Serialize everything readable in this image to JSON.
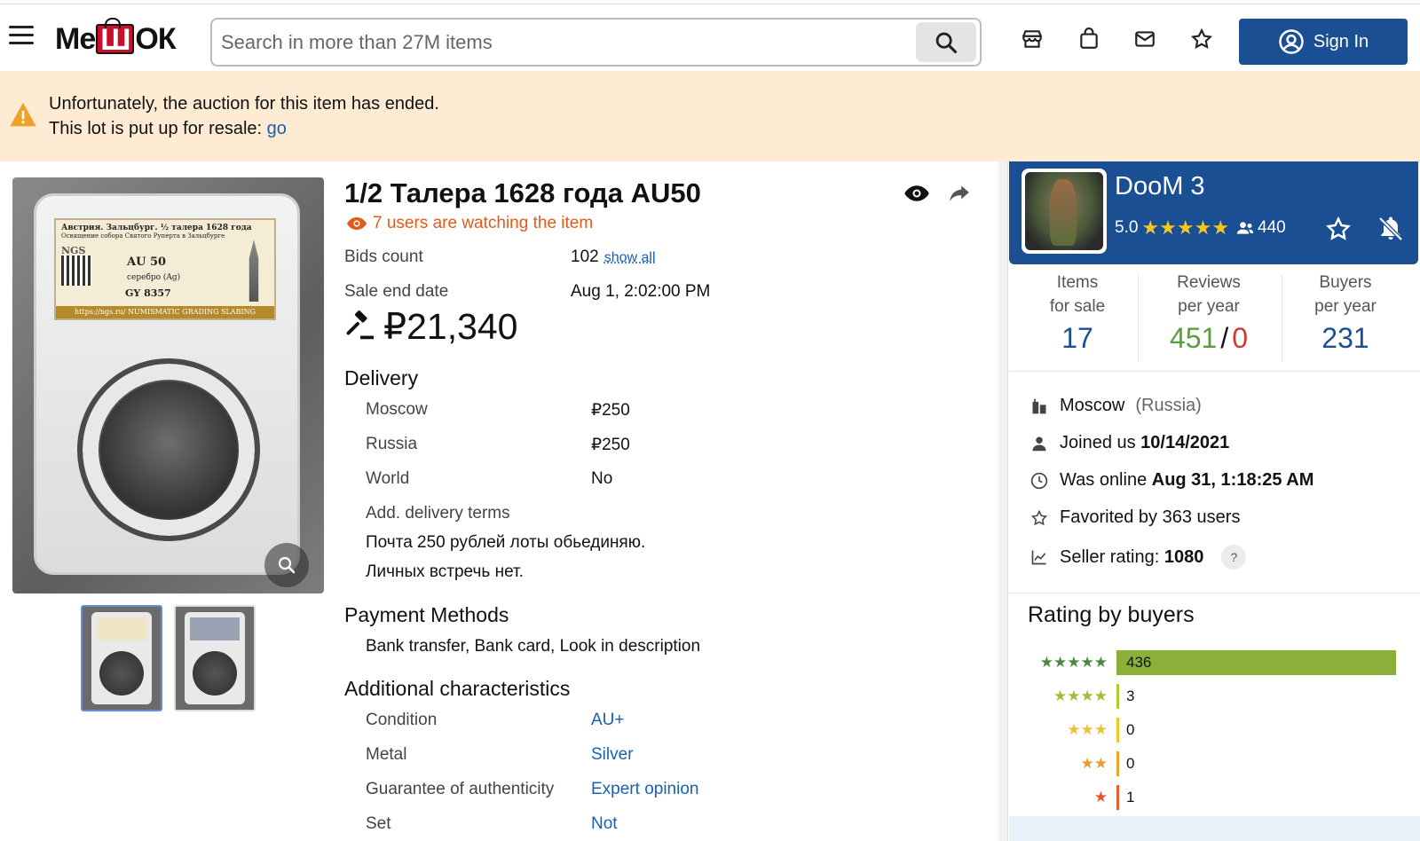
{
  "header": {
    "logo_prefix": "Ме",
    "logo_mid": "Ш",
    "logo_suffix": "ОК",
    "search_placeholder": "Search in more than 27M items",
    "sign_in": "Sign In",
    "icons": [
      "menu-icon",
      "search-icon",
      "store-icon",
      "bag-icon",
      "mail-icon",
      "star-icon",
      "user-circle-icon"
    ]
  },
  "banner": {
    "line1": "Unfortunately, the auction for this item has ended.",
    "line2_prefix": "This lot is put up for resale: ",
    "line2_link": "go"
  },
  "item": {
    "title": "1/2 Талера 1628 года AU50",
    "watching": "7 users are watching the item",
    "bids_label": "Bids count",
    "bids_value": "102",
    "bids_link": "show all",
    "sale_end_label": "Sale end date",
    "sale_end_value": "Aug 1, 2:02:00 PM",
    "price": "₽21,340",
    "image_label": {
      "line1": "Австрия. Зальцбург. ½ талера 1628 года",
      "line2": "Освящение собора Святого Руперта в Зальцбурге",
      "grade": "AU 50",
      "metal": "серебро (Ag)",
      "cert": "GY 8357",
      "brand": "NGS",
      "strip": "https://ngs.ru/ NUMISMATIC GRADING SLABING"
    }
  },
  "delivery": {
    "heading": "Delivery",
    "rows": [
      {
        "label": "Moscow",
        "value": "₽250"
      },
      {
        "label": "Russia",
        "value": "₽250"
      },
      {
        "label": "World",
        "value": "No"
      }
    ],
    "terms_label": "Add. delivery terms",
    "terms_line1": "Почта 250 рублей лоты обьединяю.",
    "terms_line2": "Личных встречь нет."
  },
  "payment": {
    "heading": "Payment Methods",
    "value": "Bank transfer, Bank card, Look in description"
  },
  "characteristics": {
    "heading": "Additional characteristics",
    "rows": [
      {
        "label": "Condition",
        "value": "AU+"
      },
      {
        "label": "Metal",
        "value": "Silver"
      },
      {
        "label": "Guarantee of authenticity",
        "value": "Expert opinion"
      },
      {
        "label": "Set",
        "value": "Not"
      }
    ]
  },
  "seller": {
    "name": "DooM 3",
    "rating": "5.0",
    "stars": "★★★★★",
    "followers": "440",
    "stats": [
      {
        "label1": "Items",
        "label2": "for sale",
        "value": "17"
      },
      {
        "label1": "Reviews",
        "label2": "per year",
        "positive": "451",
        "sep": "/",
        "negative": "0"
      },
      {
        "label1": "Buyers",
        "label2": "per year",
        "value": "231"
      }
    ],
    "city": "Moscow",
    "country": "(Russia)",
    "joined_prefix": "Joined us ",
    "joined_date": "10/14/2021",
    "online_prefix": "Was online ",
    "online_date": "Aug 31, 1:18:25 AM",
    "favorited": "Favorited by 363 users",
    "rating_prefix": "Seller rating: ",
    "rating_value": "1080",
    "help": "?"
  },
  "rating_by_buyers": {
    "heading": "Rating by buyers",
    "rows": [
      {
        "stars": "★★★★★",
        "count": "436",
        "fraction": 0.999,
        "color": "#8bb03a",
        "star_color": "#4b8a3a"
      },
      {
        "stars": "★★★★",
        "count": "3",
        "fraction": 0.007,
        "color": "#b5c92f",
        "star_color": "#9cbf36"
      },
      {
        "stars": "★★★",
        "count": "0",
        "fraction": 0,
        "color": "#f3c623",
        "star_color": "#efc233"
      },
      {
        "stars": "★★",
        "count": "0",
        "fraction": 0,
        "color": "#f0a12a",
        "star_color": "#ee9a2c"
      },
      {
        "stars": "★",
        "count": "1",
        "fraction": 0.002,
        "color": "#e8602c",
        "star_color": "#e5532f"
      }
    ]
  },
  "colors": {
    "brand_blue": "#1b4f93",
    "link_blue": "#1b5fb0",
    "banner_bg": "#fdebd3",
    "watching_orange": "#e25a1c",
    "positive_green": "#5a9e3a",
    "negative_red": "#d03a2c"
  }
}
